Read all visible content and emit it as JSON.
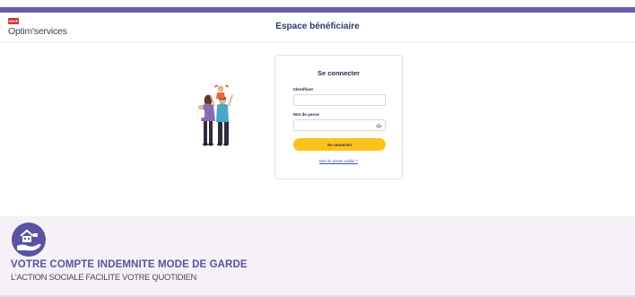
{
  "header": {
    "logo_badge": "SNCF",
    "logo_text": "Optim'services",
    "title": "Espace bénéficiaire"
  },
  "login": {
    "title": "Se connecter",
    "identifiant_label": "Identifiant",
    "identifiant_value": "",
    "password_label": "Mot de passe",
    "password_value": "",
    "submit_label": "Se connecter",
    "forgot_label": "Mot de passe oublié ?"
  },
  "banner": {
    "title": "VOTRE COMPTE INDEMNITE MODE DE GARDE",
    "subtitle": "L'ACTION SOCIALE FACILITE VOTRE QUOTIDIEN"
  },
  "icons": [
    "eye-icon",
    "family-illustration",
    "house-hand-icon"
  ],
  "colors": {
    "top_bar": "#6b5ba8",
    "primary_button": "#fcc21b",
    "banner_bg": "#f5f1f6",
    "banner_title": "#5a52a2",
    "logo_red": "#d32f2f"
  }
}
